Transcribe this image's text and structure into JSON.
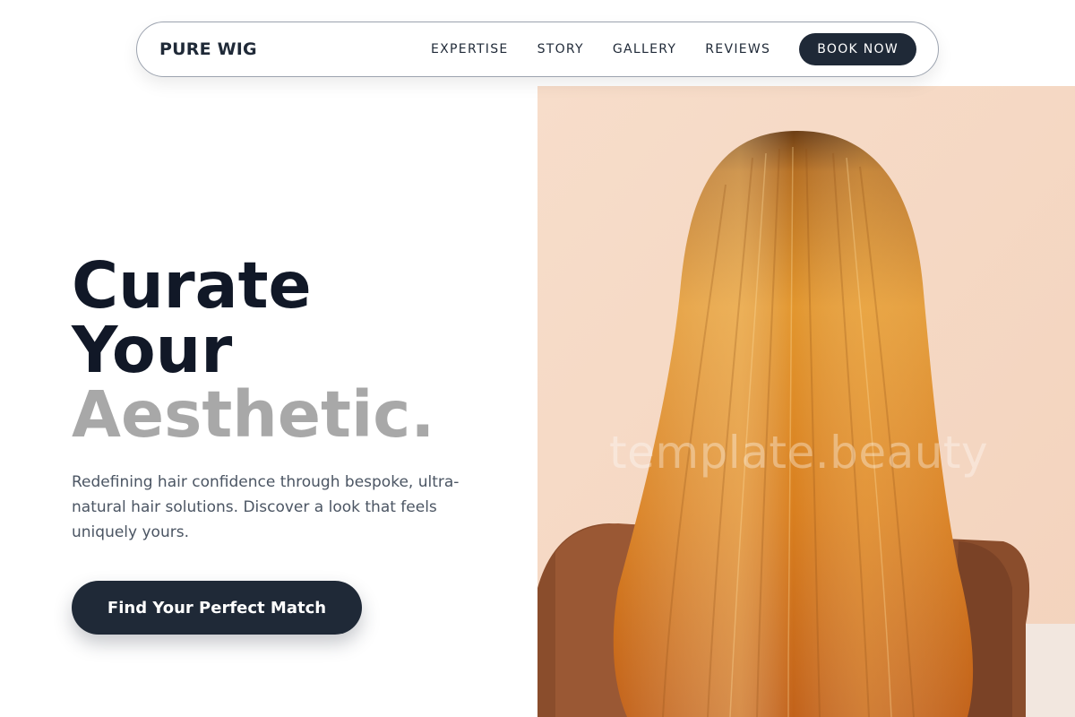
{
  "nav": {
    "brand": "PURE WIG",
    "links": [
      "EXPERTISE",
      "STORY",
      "GALLERY",
      "REVIEWS"
    ],
    "book_label": "BOOK NOW"
  },
  "hero": {
    "title_line1": "Curate",
    "title_line2": "Your",
    "title_line3": "Aesthetic.",
    "subtitle": "Redefining hair confidence through bespoke, ultra-natural hair solutions. Discover a look that feels uniquely yours.",
    "cta_label": "Find Your Perfect Match"
  },
  "image": {
    "subject": "long straight golden-orange wig on mannequin head, back view",
    "watermark": "template.beauty"
  },
  "colors": {
    "primary_dark": "#1f2937",
    "title_dark": "#111827",
    "accent_gray": "#a8a8a8",
    "body_text": "#4b5563"
  }
}
